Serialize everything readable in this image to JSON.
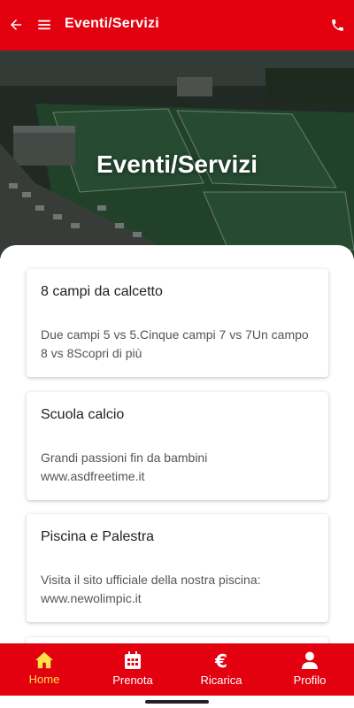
{
  "app_bar": {
    "title": "Eventi/Servizi",
    "back_icon": "back-arrow-icon",
    "menu_icon": "hamburger-menu-icon",
    "phone_icon": "phone-icon",
    "color": "#e3000f"
  },
  "hero": {
    "title": "Eventi/Servizi"
  },
  "cards": [
    {
      "title": "8 campi da calcetto",
      "description": "Due campi 5 vs 5.Cinque campi 7 vs 7Un campo 8 vs 8Scopri di più"
    },
    {
      "title": "Scuola calcio",
      "description": "Grandi passioni fin da bambini www.asdfreetime.it"
    },
    {
      "title": "Piscina e Palestra",
      "description": "Visita il sito ufficiale della nostra piscina: www.newolimpic.it"
    }
  ],
  "bottom_nav": {
    "items": [
      {
        "label": "Home",
        "icon": "home-icon",
        "active": true
      },
      {
        "label": "Prenota",
        "icon": "calendar-icon",
        "active": false
      },
      {
        "label": "Ricarica",
        "icon": "euro-icon",
        "active": false
      },
      {
        "label": "Profilo",
        "icon": "user-icon",
        "active": false
      }
    ],
    "active_color": "#ffe14a"
  }
}
